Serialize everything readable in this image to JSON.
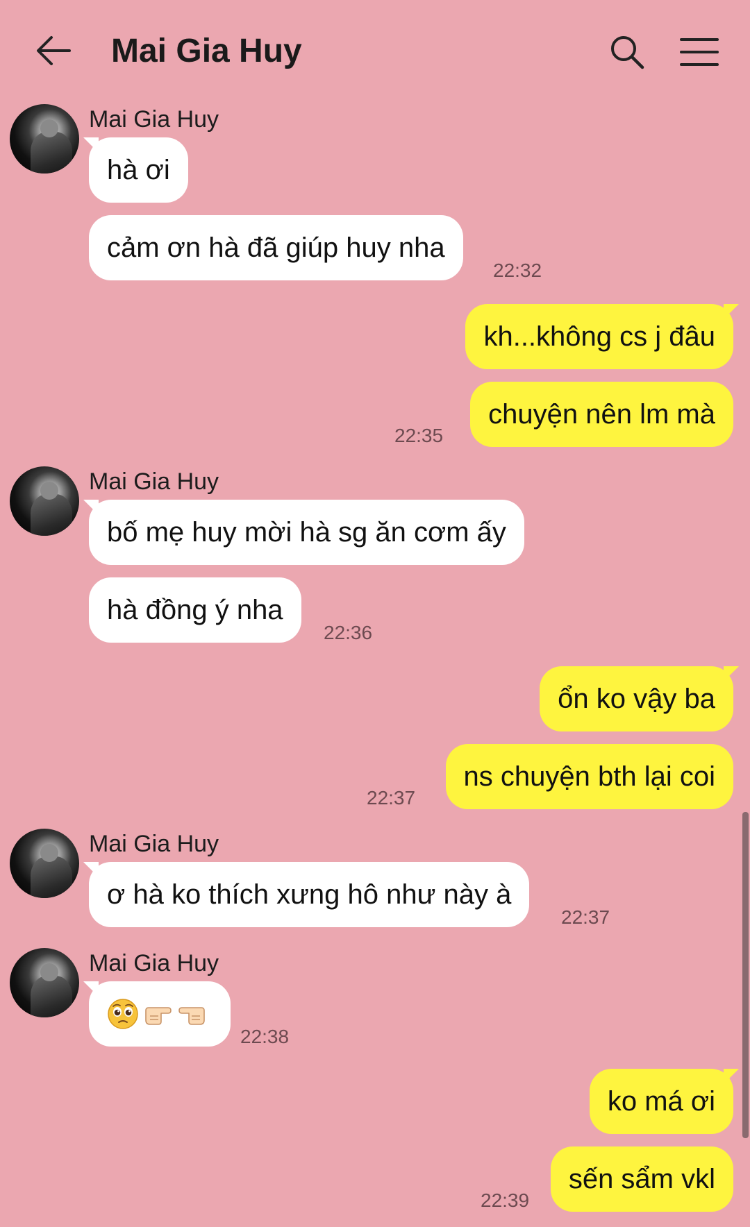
{
  "header": {
    "title": "Mai Gia Huy",
    "back_icon": "arrow-left-icon",
    "search_icon": "search-icon",
    "menu_icon": "hamburger-menu-icon"
  },
  "colors": {
    "background": "#eba7b0",
    "incoming_bubble": "#ffffff",
    "outgoing_bubble": "#fef43f"
  },
  "messages": {
    "g1": {
      "sender": "Mai Gia Huy",
      "m1": "hà ơi",
      "m2": "cảm ơn hà đã giúp huy nha",
      "time": "22:32"
    },
    "g2": {
      "m1": "kh...không cs j đâu",
      "m2": "chuyện nên lm mà",
      "time": "22:35"
    },
    "g3": {
      "sender": "Mai Gia Huy",
      "m1": "bố mẹ huy mời hà sg ăn cơm ấy",
      "m2": "hà đồng ý nha",
      "time": "22:36"
    },
    "g4": {
      "m1": "ổn ko vậy ba",
      "m2": "ns chuyện bth lại coi",
      "time": "22:37"
    },
    "g5": {
      "sender": "Mai Gia Huy",
      "m1": "ơ hà ko thích xưng hô như này à",
      "time": "22:37"
    },
    "g6": {
      "sender": "Mai Gia Huy",
      "emojis": [
        "pleading-face-emoji",
        "pointing-right-hand-emoji",
        "pointing-left-hand-emoji"
      ],
      "time": "22:38"
    },
    "g7": {
      "m1": "ko má ơi",
      "m2": "sến sẩm vkl",
      "time": "22:39"
    }
  }
}
